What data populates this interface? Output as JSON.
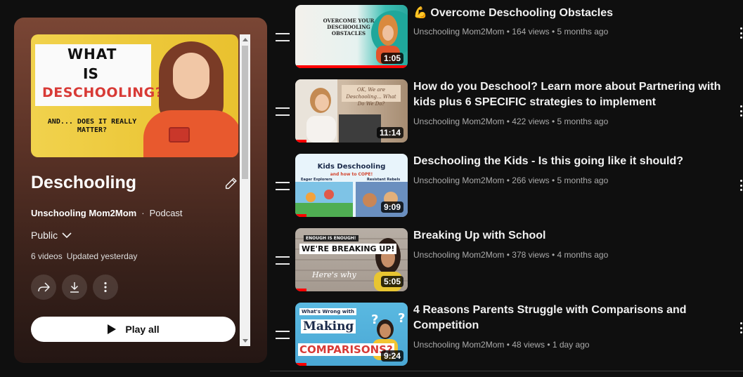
{
  "playlist": {
    "cover_text": {
      "line1": "WHAT",
      "line2": "IS",
      "line3": "DESCHOOLING?",
      "line4": "AND... DOES IT REALLY MATTER?"
    },
    "title": "Deschooling",
    "owner": "Unschooling Mom2Mom",
    "separator": "·",
    "kind": "Podcast",
    "privacy": "Public",
    "video_count": "6 videos",
    "updated": "Updated yesterday",
    "play_all_label": "Play all",
    "icons": {
      "edit": "pencil-icon",
      "share": "share-icon",
      "download": "download-icon",
      "more": "more-vert-icon",
      "play": "play-icon"
    }
  },
  "videos": [
    {
      "title": "💪 Overcome Deschooling Obstacles",
      "channel": "Unschooling Mom2Mom",
      "views": "164 views",
      "age": "5 months ago",
      "duration": "1:05",
      "progress": 1.0,
      "thumb_text": "OVERCOME YOUR DESCHOOLING OBSTACLES"
    },
    {
      "title": "How do you Deschool? Learn more about Partnering with kids plus 6 SPECIFIC strategies to implement",
      "channel": "Unschooling Mom2Mom",
      "views": "422 views",
      "age": "5 months ago",
      "duration": "11:14",
      "progress": 0.1,
      "thumb_text": "OK, We are Deschooling... What Do We Do?"
    },
    {
      "title": "Deschooling the Kids - Is this going like it should?",
      "channel": "Unschooling Mom2Mom",
      "views": "266 views",
      "age": "5 months ago",
      "duration": "9:09",
      "progress": 0.1,
      "thumb_text": "Kids Deschooling",
      "thumb_sub": "and how to COPE!",
      "thumb_left": "Eager Explorers",
      "thumb_right": "Resistant Rebels"
    },
    {
      "title": "Breaking Up with School",
      "channel": "Unschooling Mom2Mom",
      "views": "378 views",
      "age": "4 months ago",
      "duration": "5:05",
      "progress": 0.1,
      "thumb_tag": "ENOUGH IS ENOUGH!",
      "thumb_text": "WE'RE BREAKING UP!",
      "thumb_sub": "Here's why"
    },
    {
      "title": "4 Reasons Parents Struggle with Comparisons and Competition",
      "channel": "Unschooling Mom2Mom",
      "views": "48 views",
      "age": "1 day ago",
      "duration": "9:24",
      "progress": 0.1,
      "thumb_text": "What's Wrong with",
      "thumb_mid": "Making",
      "thumb_big": "COMPARISONS?"
    }
  ],
  "meta_separator": "•",
  "colors": {
    "page_bg": "#0f0f0f",
    "progress": "#ff0000",
    "meta_text": "#aaaaaa"
  }
}
